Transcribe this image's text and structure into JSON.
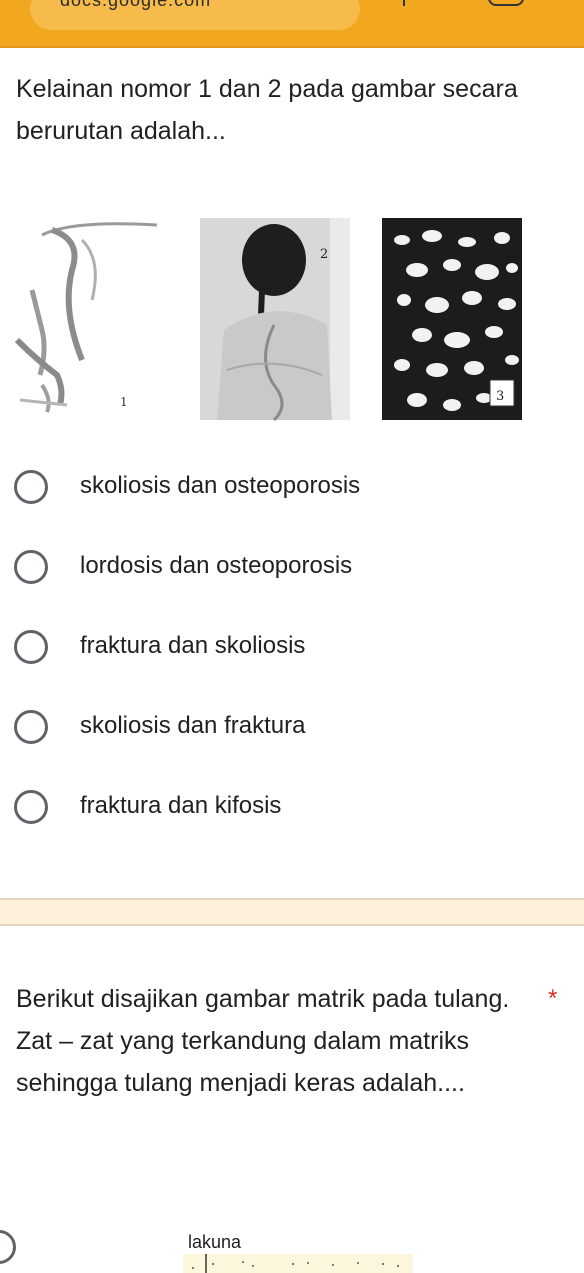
{
  "browser": {
    "url_text": "docs.google.com"
  },
  "question1": {
    "text": "Kelainan nomor 1 dan 2 pada gambar secara berurutan adalah...",
    "figure_labels": [
      "1",
      "2",
      "3"
    ],
    "options": [
      "skoliosis dan osteoporosis",
      "lordosis dan osteoporosis",
      "fraktura dan skoliosis",
      "skoliosis dan fraktura",
      "fraktura dan kifosis"
    ]
  },
  "question2": {
    "text": "Berikut disajikan gambar matrik pada tulang. Zat – zat yang terkandung dalam matriks sehingga tulang menjadi keras adalah....",
    "required_mark": "*",
    "figure_label": "lakuna"
  }
}
